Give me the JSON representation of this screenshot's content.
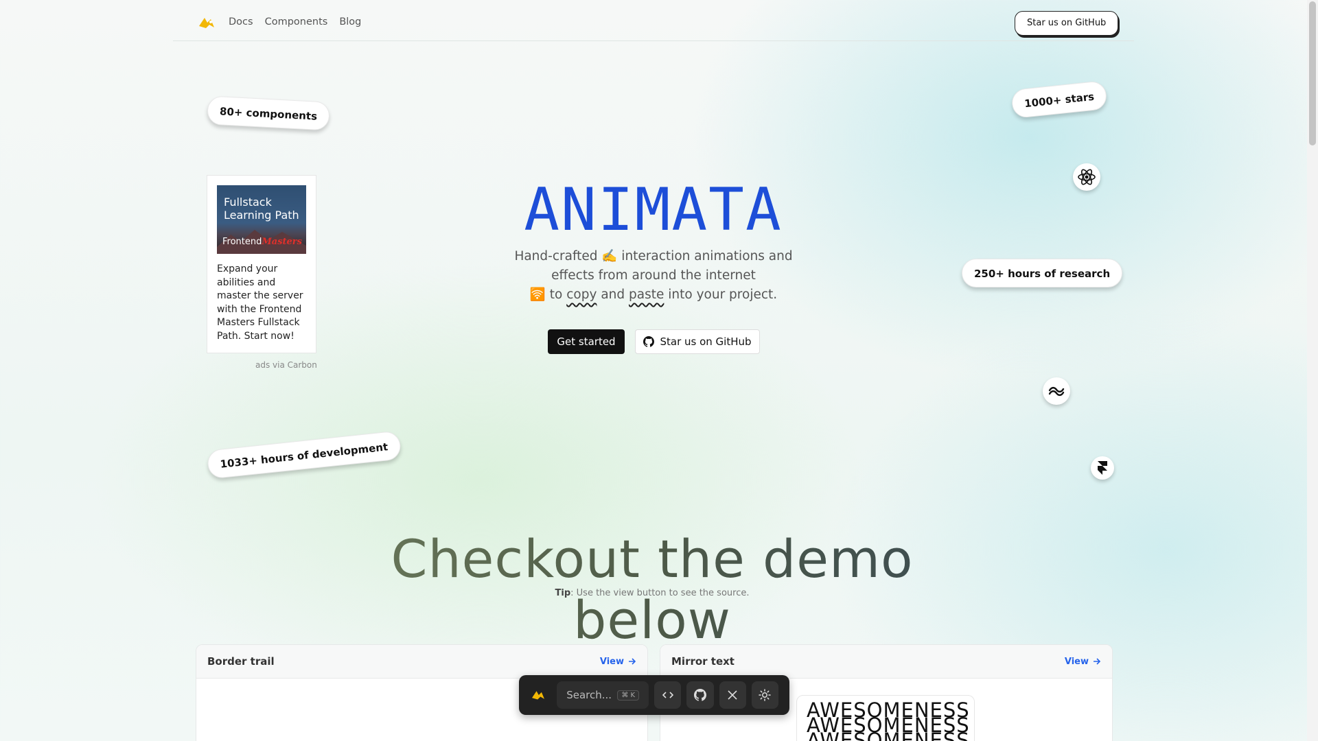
{
  "header": {
    "logo_icon": "animata-logo-icon",
    "nav": [
      "Docs",
      "Components",
      "Blog"
    ],
    "github_button": "Star us on GitHub"
  },
  "stickers": {
    "components": "80+ components",
    "stars": "1000+ stars",
    "research": "250+ hours of research",
    "development": "1033+ hours of development"
  },
  "tech_icons": [
    "react-icon",
    "tailwind-icon",
    "framer-icon"
  ],
  "ad": {
    "image_title_line1": "Fullstack",
    "image_title_line2": "Learning Path",
    "image_brand_prefix": "Frontend",
    "image_brand_suffix": "Masters",
    "text": "Expand your abilities and master the server with the Frontend Masters Fullstack Path. Start now!",
    "via": "ads via Carbon"
  },
  "hero": {
    "title": "ANIMATA",
    "sub_1": "Hand-crafted ✍️ interaction animations and effects from around the internet",
    "sub_emoji": "🛜",
    "sub_to": " to ",
    "sub_copy": "copy",
    "sub_and": " and ",
    "sub_paste": "paste",
    "sub_end": " into your project.",
    "primary_button": "Get started",
    "github_button": "Star us on GitHub"
  },
  "demo": {
    "title": "Checkout the demo below",
    "tip_label": "Tip",
    "tip_text": ": Use the view button to see the source."
  },
  "cards": [
    {
      "title": "Border trail",
      "view": "View"
    },
    {
      "title": "Mirror text",
      "view": "View",
      "preview_text": "AWESOMENESS"
    }
  ],
  "dock": {
    "search_placeholder": "Search...",
    "shortcut": "⌘ K",
    "buttons": [
      "code-icon",
      "github-icon",
      "x-icon",
      "sun-icon"
    ]
  },
  "colors": {
    "accent_blue": "#1d4ed8",
    "logo_yellow": "#f2b705",
    "link_blue": "#2563eb"
  }
}
